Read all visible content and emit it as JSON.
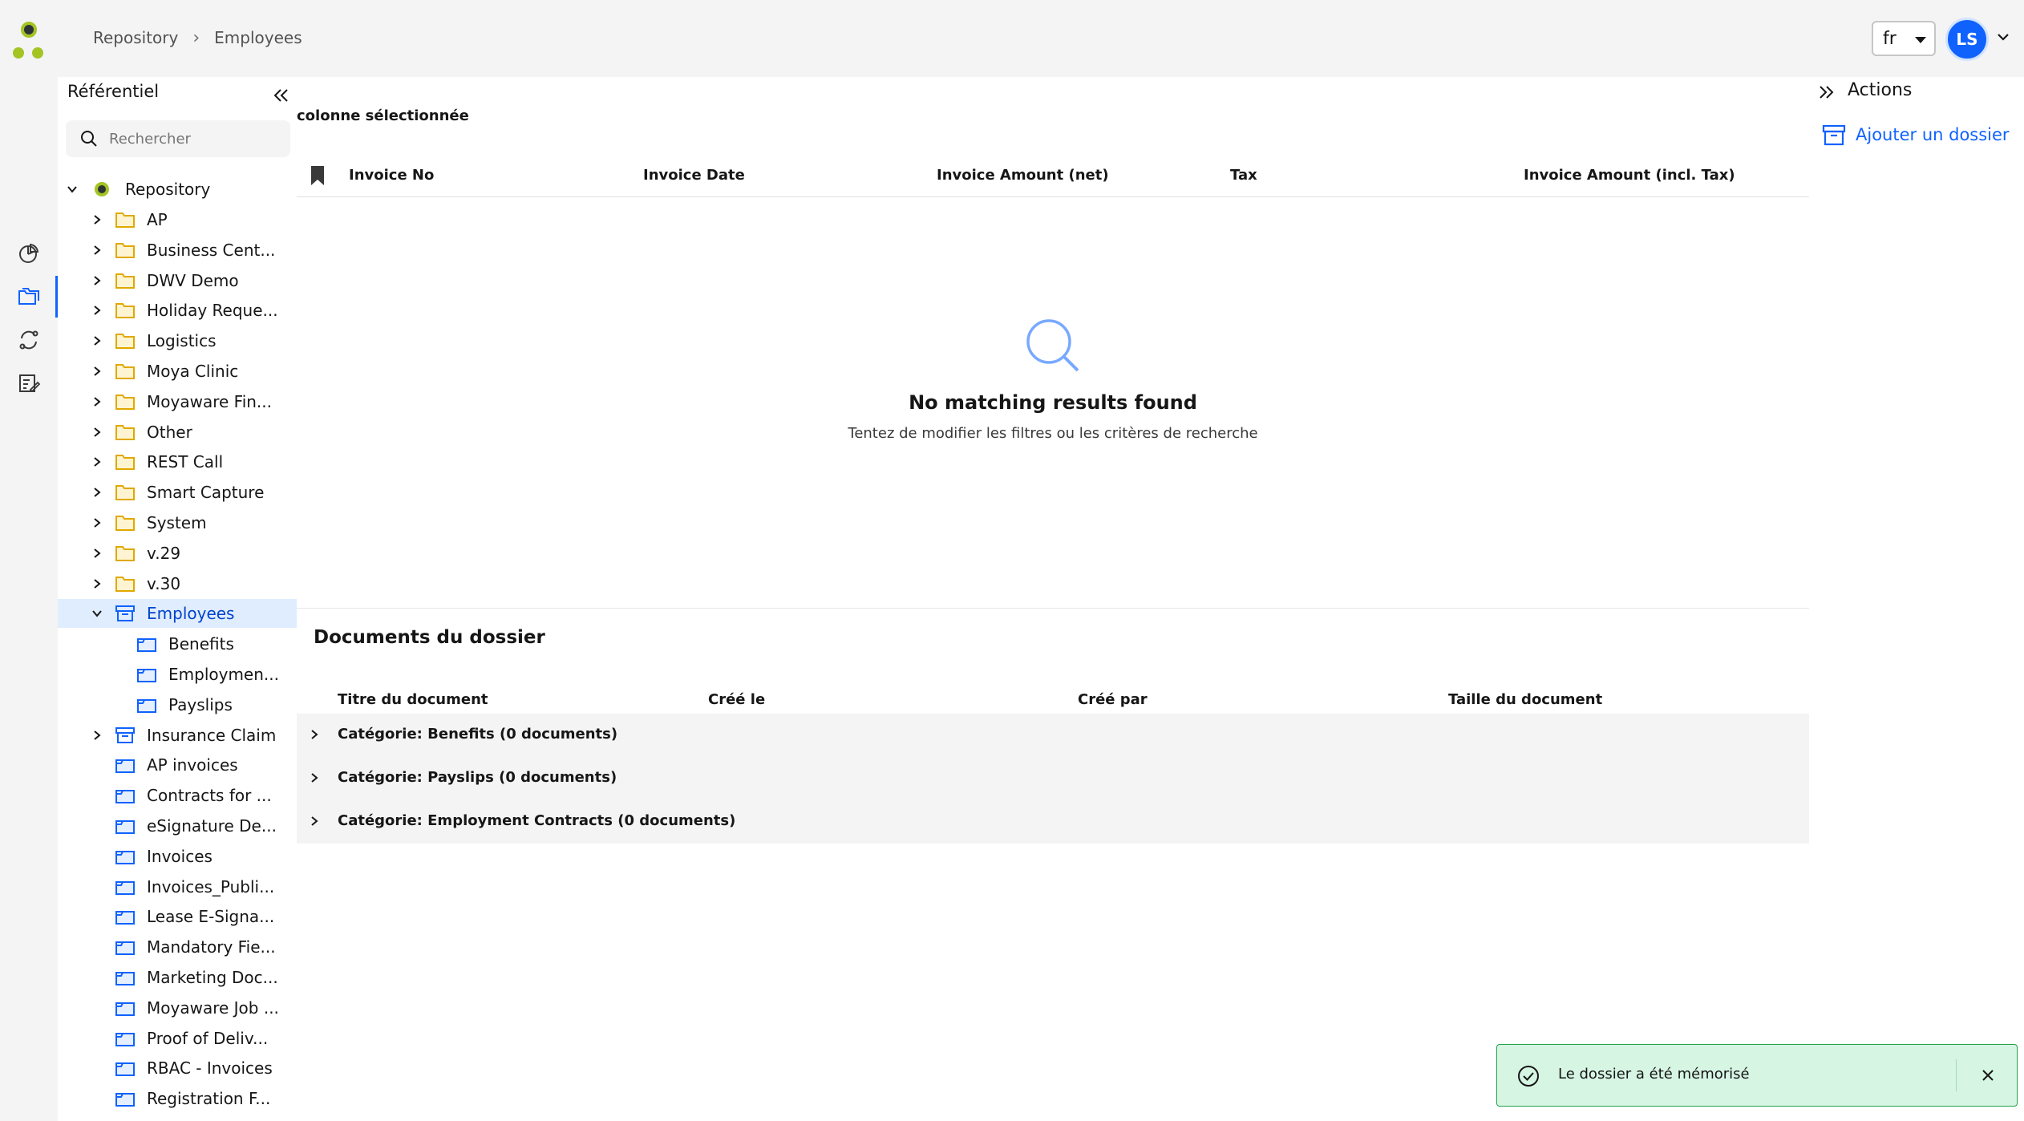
{
  "header": {
    "breadcrumb": [
      "Repository",
      "Employees"
    ],
    "language": "fr",
    "user_initials": "LS",
    "brand_colors": {
      "dark": "#2d3436",
      "lime": "#a4c423"
    }
  },
  "rail": {
    "icons": [
      "dashboard-icon",
      "folders-icon",
      "sync-icon",
      "tasks-icon"
    ],
    "active": "folders-icon"
  },
  "tree": {
    "title": "Référentiel",
    "search_placeholder": "Rechercher",
    "root": "Repository",
    "items": [
      {
        "label": "AP",
        "type": "folder"
      },
      {
        "label": "Business Cent...",
        "type": "folder"
      },
      {
        "label": "DWV Demo",
        "type": "folder"
      },
      {
        "label": "Holiday Reque...",
        "type": "folder"
      },
      {
        "label": "Logistics",
        "type": "folder"
      },
      {
        "label": "Moya Clinic",
        "type": "folder"
      },
      {
        "label": "Moyaware Fin...",
        "type": "folder"
      },
      {
        "label": "Other",
        "type": "folder"
      },
      {
        "label": "REST Call",
        "type": "folder"
      },
      {
        "label": "Smart Capture",
        "type": "folder"
      },
      {
        "label": "System",
        "type": "folder"
      },
      {
        "label": "v.29",
        "type": "folder"
      },
      {
        "label": "v.30",
        "type": "folder"
      },
      {
        "label": "Employees",
        "type": "cabinet",
        "selected": true
      },
      {
        "label": "Benefits",
        "type": "dossier"
      },
      {
        "label": "Employmen...",
        "type": "dossier"
      },
      {
        "label": "Payslips",
        "type": "dossier"
      },
      {
        "label": "Insurance Claim",
        "type": "cabinet"
      },
      {
        "label": "AP invoices",
        "type": "dossier"
      },
      {
        "label": "Contracts for ...",
        "type": "dossier"
      },
      {
        "label": "eSignature De...",
        "type": "dossier"
      },
      {
        "label": "Invoices",
        "type": "dossier"
      },
      {
        "label": "Invoices_Publi...",
        "type": "dossier"
      },
      {
        "label": "Lease E-Signa...",
        "type": "dossier"
      },
      {
        "label": "Mandatory Fie...",
        "type": "dossier"
      },
      {
        "label": "Marketing Doc...",
        "type": "dossier"
      },
      {
        "label": "Moyaware Job ...",
        "type": "dossier"
      },
      {
        "label": "Proof of Deliv...",
        "type": "dossier"
      },
      {
        "label": "RBAC - Invoices",
        "type": "dossier"
      },
      {
        "label": "Registration F...",
        "type": "dossier"
      }
    ]
  },
  "main": {
    "column_selected": "colonne sélectionnée",
    "table_headers": [
      "Invoice No",
      "Invoice Date",
      "Invoice Amount (net)",
      "Tax",
      "Invoice Amount (incl. Tax)"
    ],
    "empty_title": "No matching results found",
    "empty_subtitle": "Tentez de modifier les filtres ou les critères de recherche",
    "docs_title": "Documents du dossier",
    "docs_headers": [
      "Titre du document",
      "Créé le",
      "Créé par",
      "Taille du document"
    ],
    "categories": [
      "Catégorie: Benefits (0 documents)",
      "Catégorie: Payslips (0 documents)",
      "Catégorie: Employment Contracts (0 documents)"
    ]
  },
  "actions": {
    "title": "Actions",
    "add_folder": "Ajouter un dossier"
  },
  "toast": {
    "message": "Le dossier a été mémorisé"
  },
  "colors": {
    "accent": "#0f62fe",
    "folder_yellow": "#f1c21b",
    "folder_blue": "#0f62fe",
    "success_bg": "#d6f5e3",
    "success": "#24a148"
  }
}
